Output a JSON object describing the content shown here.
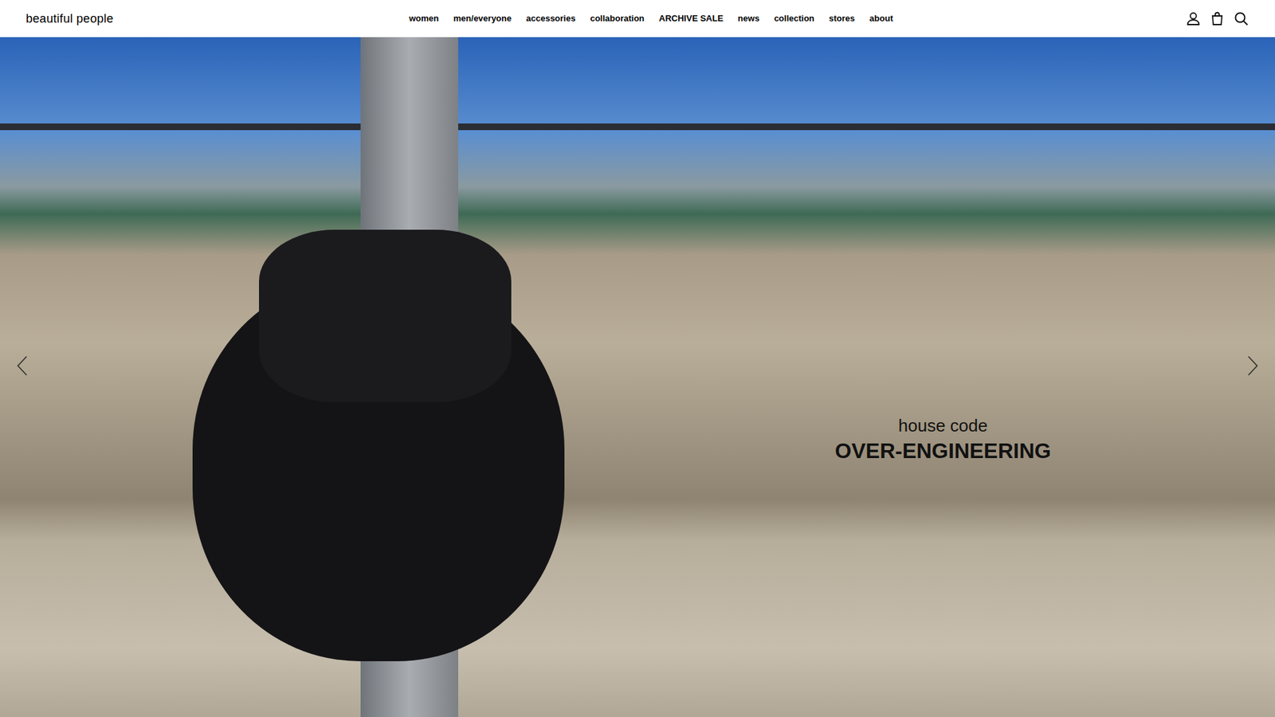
{
  "header": {
    "logo": "beautiful people",
    "nav": [
      "women",
      "men/everyone",
      "accessories",
      "collaboration",
      "ARCHIVE SALE",
      "news",
      "collection",
      "stores",
      "about"
    ]
  },
  "hero": {
    "subtitle": "house code",
    "title": "OVER-ENGINEERING"
  }
}
